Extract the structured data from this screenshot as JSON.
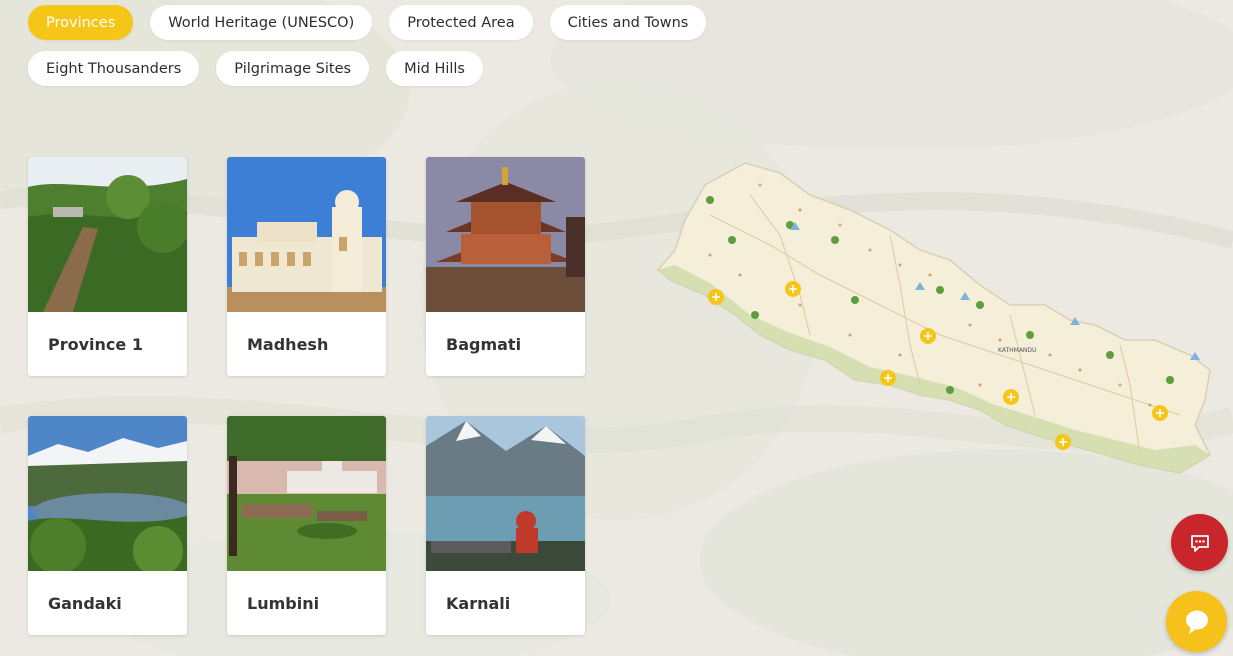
{
  "filters": {
    "row1": [
      "Provinces",
      "World Heritage (UNESCO)",
      "Protected Area",
      "Cities and Towns"
    ],
    "row2": [
      "Eight Thousanders",
      "Pilgrimage Sites",
      "Mid Hills"
    ],
    "active": "Provinces"
  },
  "provinces": [
    {
      "name": "Province 1"
    },
    {
      "name": "Madhesh"
    },
    {
      "name": "Bagmati"
    },
    {
      "name": "Gandaki"
    },
    {
      "name": "Lumbini"
    },
    {
      "name": "Karnali"
    }
  ],
  "map": {
    "capital_label": "KATHMANDU"
  },
  "icons": {
    "chat": "chat-bubble-icon",
    "messenger": "message-icon",
    "map_marker": "plus-circle-icon"
  },
  "colors": {
    "accent": "#f5c518",
    "chat_red": "#c9262c",
    "map_fill": "#f6efdc",
    "terai_green": "#c9d8a4"
  }
}
